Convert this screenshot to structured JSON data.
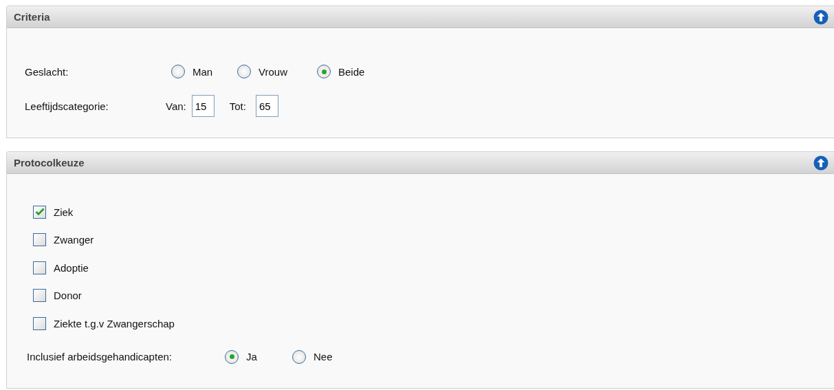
{
  "criteria": {
    "title": "Criteria",
    "expanded": true,
    "gender": {
      "label": "Geslacht:",
      "options": [
        {
          "label": "Man",
          "selected": false
        },
        {
          "label": "Vrouw",
          "selected": false
        },
        {
          "label": "Beide",
          "selected": true
        }
      ]
    },
    "age": {
      "label": "Leeftijdscategorie:",
      "from_label": "Van:",
      "from_value": "15",
      "to_label": "Tot:",
      "to_value": "65"
    }
  },
  "protocol": {
    "title": "Protocolkeuze",
    "expanded": true,
    "items": [
      {
        "label": "Ziek",
        "checked": true
      },
      {
        "label": "Zwanger",
        "checked": false
      },
      {
        "label": "Adoptie",
        "checked": false
      },
      {
        "label": "Donor",
        "checked": false
      },
      {
        "label": "Ziekte t.g.v Zwangerschap",
        "checked": false
      }
    ],
    "inclusive": {
      "label": "Inclusief arbeidsgehandicapten:",
      "options": [
        {
          "label": "Ja",
          "selected": true
        },
        {
          "label": "Nee",
          "selected": false
        }
      ]
    }
  }
}
